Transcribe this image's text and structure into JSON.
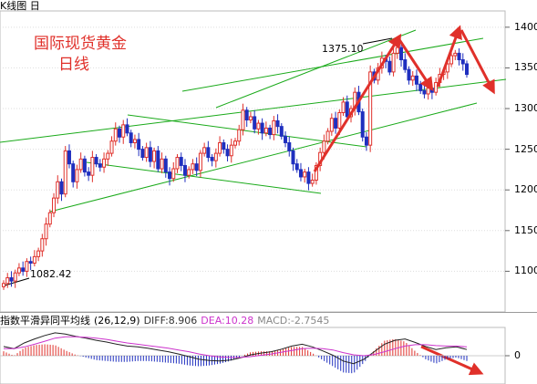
{
  "window": {
    "title": "K线图 日"
  },
  "chart_data": [
    {
      "type": "candlestick",
      "title": "国际现货黄金",
      "subtitle": "日线",
      "ylim": [
        1050,
        1420
      ],
      "yticks": [
        1100,
        1150,
        1200,
        1250,
        1300,
        1350,
        1400
      ],
      "annotations": [
        {
          "label": "1375.10",
          "value": 1375.1
        },
        {
          "label": "1082.42",
          "value": 1082.42
        }
      ],
      "series": [
        {
          "values": [
            1085,
            1092,
            1088,
            1098,
            1104,
            1100,
            1112,
            1110,
            1118,
            1125,
            1140,
            1158,
            1172,
            1190,
            1210,
            1195,
            1248,
            1232,
            1210,
            1225,
            1238,
            1222,
            1218,
            1240,
            1232,
            1228,
            1238,
            1245,
            1260,
            1275,
            1265,
            1280,
            1270,
            1258,
            1262,
            1250,
            1240,
            1252,
            1235,
            1248,
            1226,
            1238,
            1222,
            1214,
            1226,
            1240,
            1230,
            1218,
            1225,
            1232,
            1224,
            1245,
            1252,
            1240,
            1236,
            1245,
            1258,
            1250,
            1242,
            1255,
            1260,
            1274,
            1298,
            1286,
            1290,
            1275,
            1282,
            1270,
            1276,
            1268,
            1285,
            1278,
            1266,
            1258,
            1248,
            1232,
            1225,
            1216,
            1222,
            1208,
            1212,
            1230,
            1246,
            1260,
            1272,
            1288,
            1276,
            1295,
            1308,
            1290,
            1300,
            1320,
            1296,
            1265,
            1255,
            1345,
            1335,
            1350,
            1362,
            1358,
            1345,
            1368,
            1375,
            1360,
            1348,
            1335,
            1340,
            1330,
            1322,
            1318,
            1325,
            1320,
            1332,
            1342,
            1345,
            1355,
            1365,
            1368,
            1360,
            1355,
            1342
          ]
        }
      ]
    },
    {
      "type": "macd",
      "legend": {
        "name": "指数平滑异同平均线",
        "params": "(26,12,9)",
        "diff": "DIFF:8.906",
        "dea": "DEA:10.28",
        "macd": "MACD:-2.7545"
      },
      "ylim": [
        -6,
        6
      ],
      "yticks": [
        0
      ],
      "series": [
        {
          "name": "DIFF",
          "values": [
            2.1,
            1.6,
            2.9,
            3.8,
            4.6,
            5.2,
            4.9,
            4.4,
            4.0,
            3.5,
            3.1,
            2.6,
            2.2,
            2.0,
            1.7,
            1.3,
            0.9,
            0.4,
            -0.2,
            -0.8,
            -1.1,
            -1.2,
            -1.0,
            -0.5,
            0.2,
            0.6,
            0.9,
            1.5,
            2.2,
            2.6,
            2.0,
            1.1,
            0.1,
            -1.2,
            -1.8,
            -0.8,
            0.9,
            2.6,
            3.5,
            3.8,
            3.0,
            2.1,
            1.4,
            1.8,
            2.0,
            1.4
          ]
        },
        {
          "name": "DEA",
          "values": [
            1.6,
            1.6,
            2.0,
            2.6,
            3.3,
            4.0,
            4.3,
            4.3,
            4.2,
            4.0,
            3.7,
            3.3,
            2.9,
            2.6,
            2.3,
            2.0,
            1.7,
            1.3,
            0.9,
            0.4,
            0.0,
            -0.3,
            -0.4,
            -0.4,
            -0.2,
            0.1,
            0.4,
            0.8,
            1.2,
            1.6,
            1.7,
            1.6,
            1.3,
            0.7,
            0.2,
            0.0,
            0.3,
            0.9,
            1.6,
            2.2,
            2.5,
            2.5,
            2.3,
            2.2,
            2.2,
            2.0
          ]
        }
      ]
    }
  ]
}
